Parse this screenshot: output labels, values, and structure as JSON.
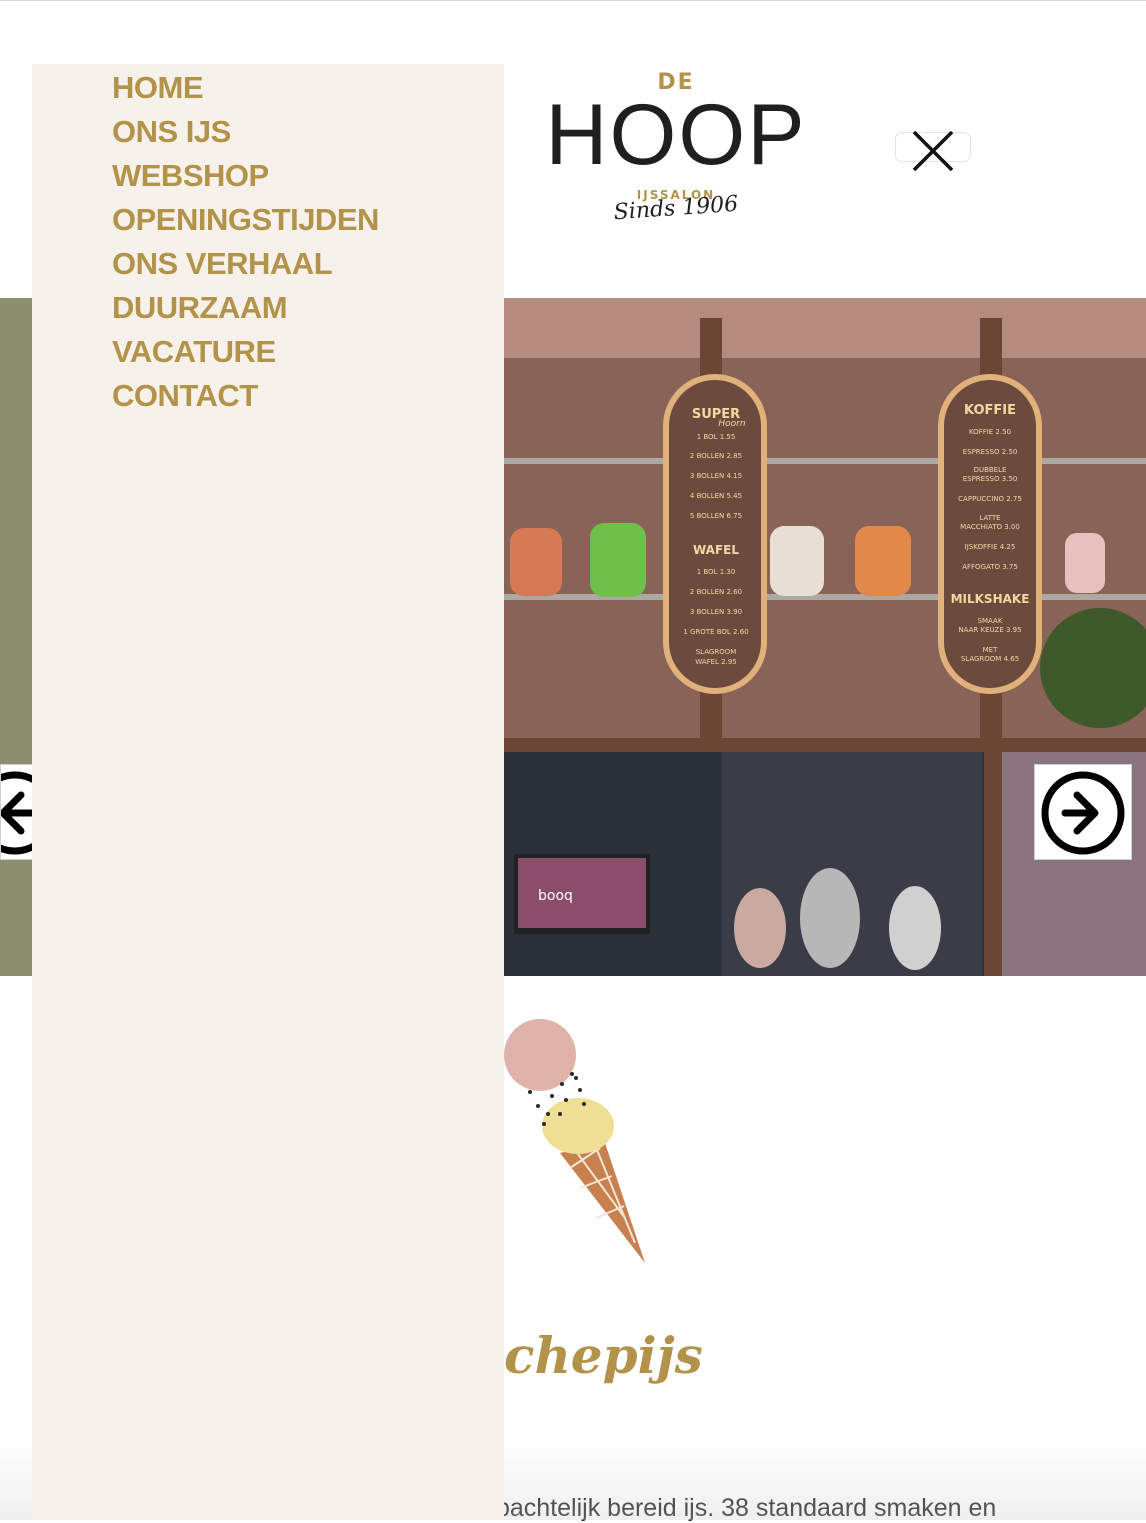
{
  "brand": {
    "top": "DE",
    "name": "HOOP",
    "subtitle": "IJSSALON",
    "since": "Sinds 1906"
  },
  "nav": {
    "items": [
      {
        "label": "HOME"
      },
      {
        "label": "ONS IJS"
      },
      {
        "label": "WEBSHOP"
      },
      {
        "label": "OPENINGSTIJDEN"
      },
      {
        "label": "ONS VERHAAL"
      },
      {
        "label": "DUURZAAM"
      },
      {
        "label": "VACATURE"
      },
      {
        "label": "CONTACT"
      }
    ]
  },
  "hero": {
    "menu_board_left": {
      "title": "SUPER",
      "title_script": "Hoorn",
      "lines": [
        "1 BOL 1.55",
        "2 BOLLEN 2.85",
        "3 BOLLEN 4.15",
        "4 BOLLEN 5.45",
        "5 BOLLEN 6.75"
      ],
      "section": "WAFEL",
      "section_lines": [
        "1 BOL 1.30",
        "2 BOLLEN 2.60",
        "3 BOLLEN 3.90",
        "1 GROTE BOL 2.60",
        "SLAGROOM",
        "WAFEL 2.95"
      ]
    },
    "menu_board_right": {
      "title": "KOFFIE",
      "lines": [
        "KOFFIE 2.50",
        "ESPRESSO 2.50",
        "DUBBELE",
        "ESPRESSO 3.50",
        "CAPPUCCINO 2.75",
        "LATTE",
        "MACCHIATO 3.00",
        "IJSKOFFIE 4.25",
        "AFFOGATO 3.75"
      ],
      "section": "MILKSHAKE",
      "section_lines": [
        "SMAAK",
        "NAAR KEUZE 3.95",
        "MET",
        "SLAGROOM 4.65"
      ]
    },
    "screen_text": "booq"
  },
  "section": {
    "heading_visible": "chepijs",
    "body_visible": "pachtelijk bereid ijs. 38 standaard smaken en"
  },
  "colors": {
    "accent": "#b39249",
    "panel": "#f6f1ea",
    "text": "#1f1f1f"
  },
  "icons": {
    "close": "close-icon",
    "next": "arrow-right-circle-icon",
    "prev": "arrow-left-circle-icon",
    "cone": "ice-cream-cone-icon"
  }
}
